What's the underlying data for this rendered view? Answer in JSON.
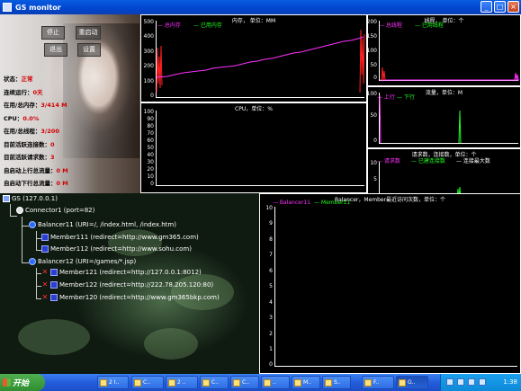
{
  "window": {
    "title": "GS monitor"
  },
  "buttons": {
    "stop": "停止",
    "restart": "重启动",
    "exit": "退出",
    "settings": "设置"
  },
  "stats": [
    {
      "label": "状态：",
      "value": "正常"
    },
    {
      "label": "连续运行：",
      "value": "0天"
    },
    {
      "label": "在用/总内存：",
      "value": "3/414 M"
    },
    {
      "label": "CPU：",
      "value": "0.0%"
    },
    {
      "label": "在用/总线程：",
      "value": "3/200"
    },
    {
      "label": "目前活跃连接数：",
      "value": "0"
    },
    {
      "label": "目前活跃请求数：",
      "value": "3"
    },
    {
      "label": "自启动上行总流量：",
      "value": "0 M"
    },
    {
      "label": "自启动下行总流量：",
      "value": "0 M"
    }
  ],
  "charts": {
    "memory": {
      "title": "内存， 单位：MM",
      "legend": [
        "总内存",
        "已用内存"
      ],
      "yticks": [
        "500",
        "400",
        "300",
        "200",
        "100",
        "0"
      ],
      "colors": {
        "total": "#ff2020",
        "used": "#ff30ff"
      }
    },
    "cpu": {
      "title": "CPU，单位：%",
      "yticks": [
        "100",
        "90",
        "80",
        "70",
        "60",
        "50",
        "40",
        "30",
        "20",
        "10",
        "0"
      ]
    },
    "threads": {
      "title": "线程， 单位：个",
      "legend": [
        "总线程",
        "已用线程"
      ],
      "yticks": [
        "200",
        "150",
        "100",
        "50",
        "0"
      ],
      "colors": {
        "total": "#ff2020",
        "used": "#ff30ff"
      }
    },
    "traffic": {
      "title": "流量，单位：M",
      "legend": [
        "上行",
        "下行"
      ],
      "yticks": [
        "100",
        "50",
        "0"
      ],
      "colors": {
        "up": "#ff30ff",
        "down": "#20ff20"
      }
    },
    "connections": {
      "title": "请求数，连接数，单位：个",
      "legend": [
        "请求数",
        "已建连接数",
        "连接最大数"
      ],
      "yticks": [
        "10",
        "5",
        "0"
      ],
      "colors": {
        "req": "#ff30ff",
        "est": "#20ff20",
        "max": "#ffffff"
      }
    },
    "balancer": {
      "title": "Balancer，Member最近访问次数，单位：个",
      "legend": [
        "Balancer11",
        "Member11"
      ],
      "yticks": [
        "10",
        "9",
        "8",
        "7",
        "6",
        "5",
        "4",
        "3",
        "2",
        "1",
        "0"
      ],
      "colors": {
        "balancer": "#ff30ff",
        "member": "#20ff20"
      }
    }
  },
  "tree": {
    "root": "GS (127.0.0.1)",
    "connector": "Connector1 (port=82)",
    "balancer1": "Balancer11 (URI=/, /index.html, /index.htm)",
    "member111": "Member111 (redirect=http://www.gm365.com)",
    "member112": "Member112 (redirect=http://www.sohu.com)",
    "balancer2": "Balancer12 (URI=/games/*.jsp)",
    "member121": "Member121 (redirect=http://127.0.0.1:8012)",
    "member122": "Member122 (redirect=http://222.78.205.120:80)",
    "member120": "Member120 (redirect=http://www.gm365bkp.com)"
  },
  "taskbar": {
    "start": "开始",
    "tasks": [
      "2 I..",
      "C..",
      "2 ..",
      "C..",
      "C..",
      "..",
      "M..",
      "S..",
      "F..",
      "G.."
    ],
    "clock": "1:38"
  }
}
